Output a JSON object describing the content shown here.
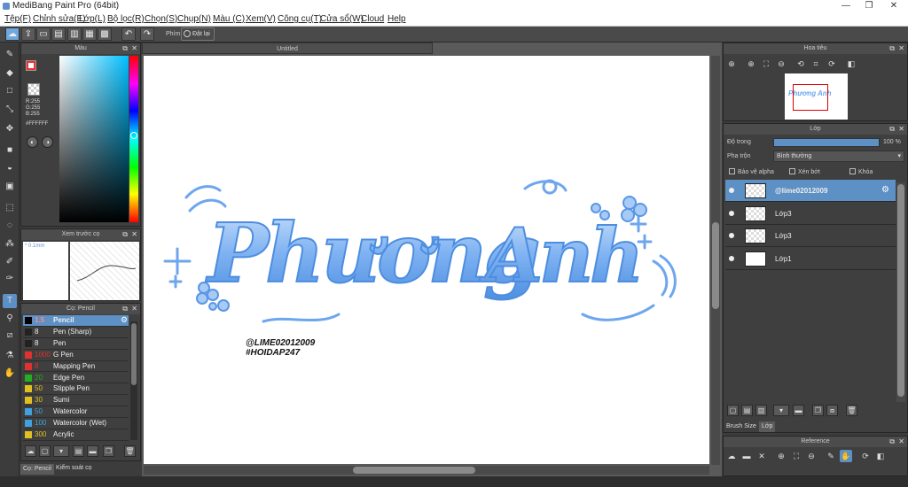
{
  "window": {
    "title": "MediBang Paint Pro (64bit)",
    "min": "—",
    "max": "❐",
    "close": "✕"
  },
  "menu": [
    "Tệp(F)",
    "Chỉnh sửa(E)",
    "Lớp(L)",
    "Bộ lọc(R)",
    "Chọn(S)",
    "Chụp(N)",
    "Màu (C)",
    "Xem(V)",
    "Công cụ(T)",
    "Cửa sổ(W)",
    "Cloud",
    "Help"
  ],
  "toolbar": {
    "key_label": "Phím",
    "reset_label": "Đặt lại",
    "undo": "↶",
    "redo": "↷"
  },
  "color_panel": {
    "title": "Màu",
    "r": "R:255",
    "g": "G:255",
    "b": "B:255",
    "hex": "#FFFFFF",
    "fg_color": "#FFFFFF",
    "bg_color": "#E85C1C"
  },
  "brush_preview": {
    "title": "Xem trước cọ",
    "size_label": "* 0.1mm"
  },
  "brush_panel": {
    "title": "Cọ: Pencil",
    "brushes": [
      {
        "size": "1.5",
        "name": "Pencil",
        "color": "#000000",
        "selected": true
      },
      {
        "size": "8",
        "name": "Pen (Sharp)",
        "color": "#222222"
      },
      {
        "size": "8",
        "name": "Pen",
        "color": "#222222"
      },
      {
        "size": "1000",
        "name": "G Pen",
        "color": "#e03030"
      },
      {
        "size": "8",
        "name": "Mapping Pen",
        "color": "#e03030"
      },
      {
        "size": "20",
        "name": "Edge Pen",
        "color": "#20b020"
      },
      {
        "size": "50",
        "name": "Stipple Pen",
        "color": "#e0c020"
      },
      {
        "size": "30",
        "name": "Sumi",
        "color": "#e0c020"
      },
      {
        "size": "50",
        "name": "Watercolor",
        "color": "#40a0e0"
      },
      {
        "size": "100",
        "name": "Watercolor (Wet)",
        "color": "#40a0e0"
      },
      {
        "size": "300",
        "name": "Acrylic",
        "color": "#e0c020"
      }
    ],
    "tab_brush": "Cọ: Pencil",
    "tab_control": "Kiểm soát cọ"
  },
  "document": {
    "tab_title": "Untitled",
    "artwork_text_1": "Phương",
    "artwork_text_2": "Anh",
    "watermark_1": "@LIME02012009",
    "watermark_2": "#HOIDAP247"
  },
  "navigator": {
    "title": "Hoa tiêu",
    "thumb_text": "Phương Anh"
  },
  "layer_panel": {
    "title": "Lớp",
    "opacity_label": "Độ trong",
    "opacity_value": "100 %",
    "blend_label": "Pha trộn",
    "blend_value": "Bình thường",
    "protect_alpha": "Bảo vệ alpha",
    "clipping": "Xén bớt",
    "lock": "Khóa",
    "layers": [
      {
        "name": "@lime02012009",
        "selected": true
      },
      {
        "name": "Lớp3"
      },
      {
        "name": "Lớp3"
      },
      {
        "name": "Lớp1"
      }
    ],
    "tab_brush_size": "Brush Size",
    "tab_layer": "Lớp"
  },
  "reference": {
    "title": "Reference"
  }
}
